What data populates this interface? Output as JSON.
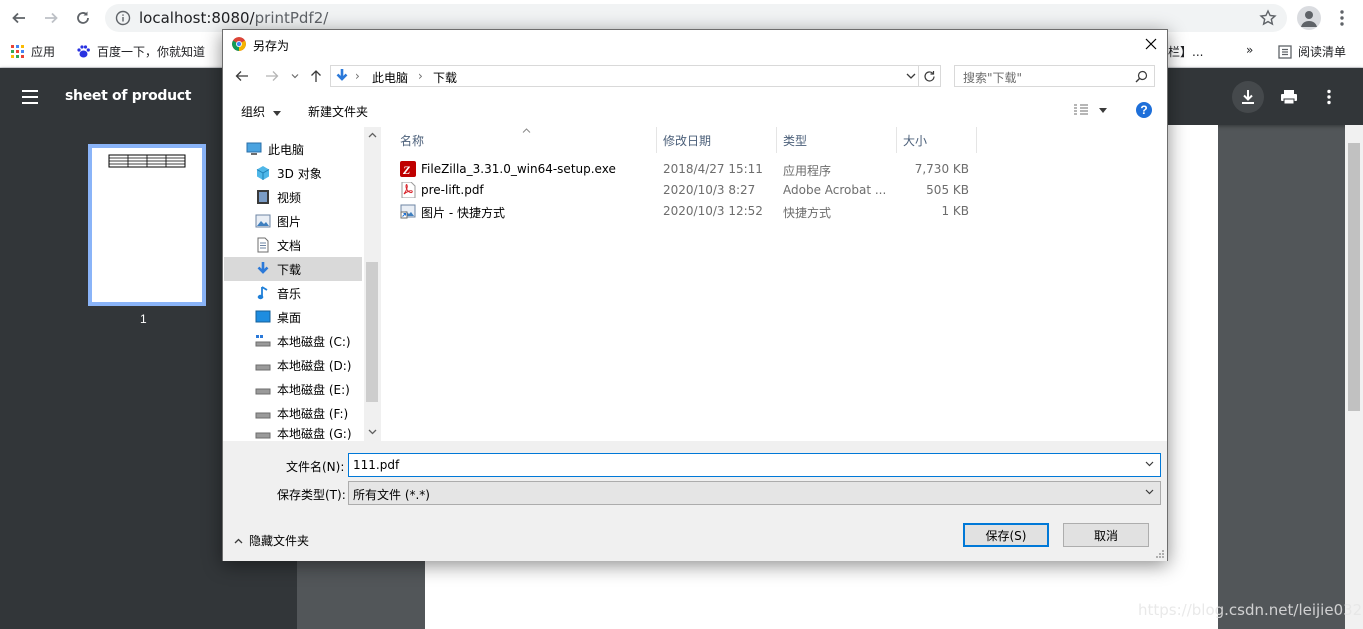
{
  "browser": {
    "url_host": "localhost:8080/",
    "url_path": "printPdf2/",
    "bookmarks": {
      "apps": "应用",
      "baidu": "百度一下，你就知道",
      "truncated": "栏】...",
      "overflow": "»",
      "reading_list": "阅读清单"
    }
  },
  "pdf": {
    "title": "sheet of product",
    "page_number": "1",
    "watermark": "https://blog.csdn.net/leijie0322"
  },
  "dialog": {
    "title": "另存为",
    "breadcrumb": [
      "此电脑",
      "下载"
    ],
    "search_placeholder": "搜索\"下载\"",
    "toolbar": {
      "organize": "组织",
      "new_folder": "新建文件夹"
    },
    "nav_items": [
      {
        "label": "此电脑",
        "icon": "computer-icon"
      },
      {
        "label": "3D 对象",
        "icon": "cube-icon"
      },
      {
        "label": "视频",
        "icon": "video-icon"
      },
      {
        "label": "图片",
        "icon": "picture-icon"
      },
      {
        "label": "文档",
        "icon": "document-icon"
      },
      {
        "label": "下载",
        "icon": "download-icon",
        "selected": true
      },
      {
        "label": "音乐",
        "icon": "music-icon"
      },
      {
        "label": "桌面",
        "icon": "desktop-icon"
      },
      {
        "label": "本地磁盘 (C:)",
        "icon": "drive-icon"
      },
      {
        "label": "本地磁盘 (D:)",
        "icon": "drive-icon"
      },
      {
        "label": "本地磁盘 (E:)",
        "icon": "drive-icon"
      },
      {
        "label": "本地磁盘 (F:)",
        "icon": "drive-icon"
      },
      {
        "label": "本地磁盘 (G:)",
        "icon": "drive-icon"
      }
    ],
    "columns": {
      "name": "名称",
      "modified": "修改日期",
      "type": "类型",
      "size": "大小"
    },
    "files": [
      {
        "name": "FileZilla_3.31.0_win64-setup.exe",
        "modified": "2018/4/27 15:11",
        "type": "应用程序",
        "size": "7,730 KB",
        "icon": "filezilla-icon"
      },
      {
        "name": "pre-lift.pdf",
        "modified": "2020/10/3 8:27",
        "type": "Adobe Acrobat ...",
        "size": "505 KB",
        "icon": "pdf-icon"
      },
      {
        "name": "图片 - 快捷方式",
        "modified": "2020/10/3 12:52",
        "type": "快捷方式",
        "size": "1 KB",
        "icon": "shortcut-icon"
      }
    ],
    "filename_label": "文件名(N):",
    "filename_value": "111.pdf",
    "filetype_label": "保存类型(T):",
    "filetype_value": "所有文件 (*.*)",
    "hide_folders": "隐藏文件夹",
    "save": "保存(S)",
    "cancel": "取消"
  }
}
